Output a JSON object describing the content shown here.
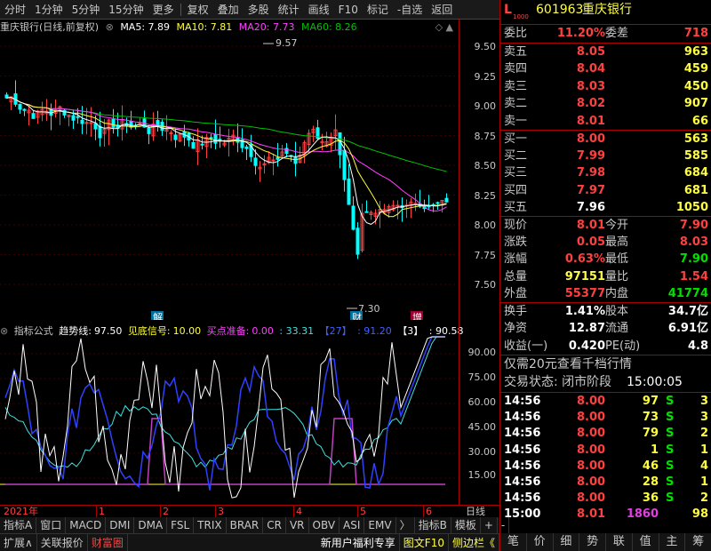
{
  "toolbar": [
    "分时",
    "1分钟",
    "5分钟",
    "15分钟",
    "更多",
    "复权",
    "叠加",
    "多股",
    "统计",
    "画线",
    "F10",
    "标记",
    "-自选",
    "返回"
  ],
  "header": {
    "title": "重庆银行(日线,前复权)",
    "ma5": "MA5: 7.89",
    "ma10": "MA10: 7.81",
    "ma20": "MA20: 7.73",
    "ma60": "MA60: 8.26"
  },
  "price_axis": [
    "9.50",
    "9.25",
    "9.00",
    "8.75",
    "8.50",
    "8.25",
    "8.00",
    "7.75",
    "7.50"
  ],
  "annotations": {
    "high": "9.57",
    "low": "7.30",
    "mark1": "解",
    "mark2": "财",
    "mark3": "增"
  },
  "indicator": {
    "name": "指标公式",
    "trend_label": "趋势线:",
    "trend_val": "97.50",
    "bottom_label": "见底信号:",
    "bottom_val": "10.00",
    "buy_label": "买点准备:",
    "buy_val": "0.00",
    "v1": ": 33.31",
    "v2": "【27】",
    "v3": ": 91.20",
    "v4": "【3】",
    "v5": ": 90.58"
  },
  "ind_axis": [
    "90.00",
    "75.00",
    "60.00",
    "45.00",
    "30.00",
    "15.00"
  ],
  "date_bar": {
    "year": "2021年",
    "m1": "1",
    "m2": "2",
    "m3": "3",
    "m4": "4",
    "m5": "5",
    "m6": "6",
    "period": "日线"
  },
  "tabs1": [
    "指标A",
    "窗口",
    "MACD",
    "DMI",
    "DMA",
    "FSL",
    "TRIX",
    "BRAR",
    "CR",
    "VR",
    "OBV",
    "ASI",
    "EMV",
    "〉",
    "指标B",
    "模板",
    "+",
    "-"
  ],
  "tabs2": [
    "扩展∧",
    "关联报价",
    "财富圈",
    "新用户福利专享",
    "图文F10",
    "侧边栏《"
  ],
  "stock": {
    "code": "601963",
    "name": "重庆银行",
    "logo": "L",
    "sub": "1000"
  },
  "weibi": {
    "l": "委比",
    "p": "11.20%",
    "l2": "委差",
    "v": "718"
  },
  "sells": [
    {
      "l": "卖五",
      "p": "8.05",
      "v": "963"
    },
    {
      "l": "卖四",
      "p": "8.04",
      "v": "459"
    },
    {
      "l": "卖三",
      "p": "8.03",
      "v": "450"
    },
    {
      "l": "卖二",
      "p": "8.02",
      "v": "907"
    },
    {
      "l": "卖一",
      "p": "8.01",
      "v": "66"
    }
  ],
  "buys": [
    {
      "l": "买一",
      "p": "8.00",
      "v": "563"
    },
    {
      "l": "买二",
      "p": "7.99",
      "v": "585"
    },
    {
      "l": "买三",
      "p": "7.98",
      "v": "684"
    },
    {
      "l": "买四",
      "p": "7.97",
      "v": "681"
    },
    {
      "l": "买五",
      "p": "7.96",
      "v": "1050"
    }
  ],
  "quote": [
    {
      "l": "现价",
      "p": "8.01",
      "l2": "今开",
      "v": "7.90"
    },
    {
      "l": "涨跌",
      "p": "0.05",
      "l2": "最高",
      "v": "8.03"
    },
    {
      "l": "涨幅",
      "p": "0.63%",
      "l2": "最低",
      "v": "7.90"
    },
    {
      "l": "总量",
      "p": "97151",
      "l2": "量比",
      "v": "1.54"
    },
    {
      "l": "外盘",
      "p": "55377",
      "l2": "内盘",
      "v": "41774"
    }
  ],
  "stats": [
    {
      "l": "换手",
      "p": "1.41%",
      "l2": "股本",
      "v": "34.7亿"
    },
    {
      "l": "净资",
      "p": "12.87",
      "l2": "流通",
      "v": "6.91亿"
    },
    {
      "l": "收益(一)",
      "p": "0.420",
      "l2": "PE(动)",
      "v": "4.8"
    }
  ],
  "promo": "仅需20元查看千档行情",
  "trade_status": {
    "label": "交易状态: 闭市阶段",
    "time": "15:00:05"
  },
  "ticks": [
    {
      "t": "14:56",
      "p": "8.00",
      "v": "97",
      "s": "S",
      "n": "3"
    },
    {
      "t": "14:56",
      "p": "8.00",
      "v": "73",
      "s": "S",
      "n": "3"
    },
    {
      "t": "14:56",
      "p": "8.00",
      "v": "79",
      "s": "S",
      "n": "2"
    },
    {
      "t": "14:56",
      "p": "8.00",
      "v": "1",
      "s": "S",
      "n": "1"
    },
    {
      "t": "14:56",
      "p": "8.00",
      "v": "46",
      "s": "S",
      "n": "4"
    },
    {
      "t": "14:56",
      "p": "8.00",
      "v": "28",
      "s": "S",
      "n": "1"
    },
    {
      "t": "14:56",
      "p": "8.00",
      "v": "36",
      "s": "S",
      "n": "2"
    },
    {
      "t": "15:00",
      "p": "8.01",
      "v": "1860",
      "s": "",
      "n": "98"
    }
  ],
  "bottom_tabs": [
    "笔",
    "价",
    "细",
    "势",
    "联",
    "值",
    "主",
    "筹"
  ],
  "colors": {
    "up": "#ff4040",
    "down": "#00ffff",
    "ma5": "#ffffff",
    "ma10": "#ffff40",
    "ma20": "#ff40ff",
    "ma60": "#00c000",
    "axis": "#aa0000"
  }
}
